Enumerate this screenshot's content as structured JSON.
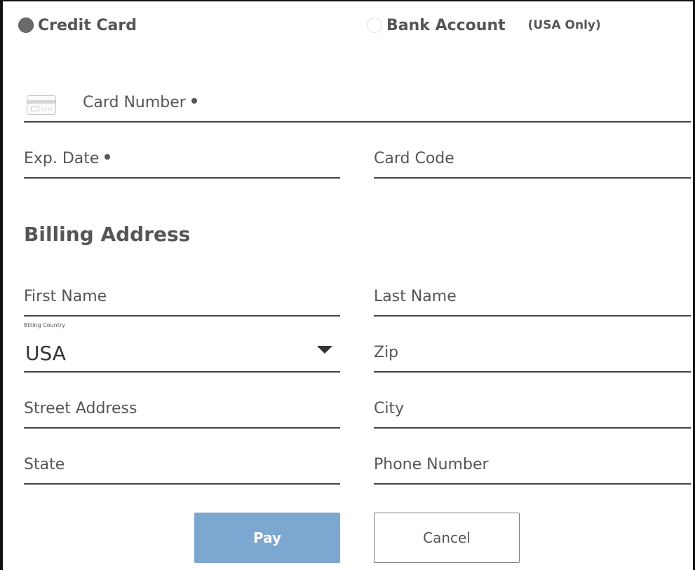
{
  "payment_method": {
    "credit_card_label": "Credit Card",
    "credit_card_selected": true,
    "bank_account_label": "Bank Account",
    "bank_account_selected": false,
    "bank_account_note": "(USA Only)"
  },
  "card": {
    "icon": "credit-card-icon",
    "card_number_placeholder": "Card Number",
    "card_number_required": true,
    "exp_date_placeholder": "Exp. Date",
    "exp_date_required": true,
    "card_code_placeholder": "Card Code"
  },
  "billing": {
    "title": "Billing Address",
    "first_name_placeholder": "First Name",
    "last_name_placeholder": "Last Name",
    "country_caption": "Billing Country",
    "country_value": "USA",
    "zip_placeholder": "Zip",
    "street_placeholder": "Street Address",
    "city_placeholder": "City",
    "state_placeholder": "State",
    "phone_placeholder": "Phone Number"
  },
  "actions": {
    "pay_label": "Pay",
    "cancel_label": "Cancel"
  },
  "colors": {
    "pay_button": "#7ba7d1",
    "text": "#555555",
    "underline": "#444444"
  }
}
